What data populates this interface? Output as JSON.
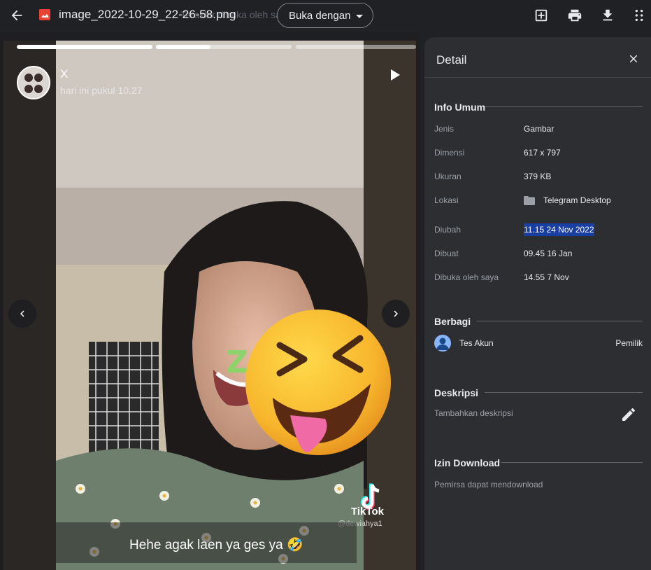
{
  "topbar": {
    "filename": "image_2022-10-29_22-26-58.png",
    "ghost_text": "Terakhir dibuka oleh saya · Disimpan di D",
    "open_with_label": "Buka dengan"
  },
  "story": {
    "progress": [
      1.0,
      0.4,
      0.0
    ],
    "username": "X",
    "time": "hari ini pukul 10.27",
    "tiktok_label": "TikTok",
    "tiktok_user": "@dewiahya1",
    "caption": "Hehe agak laen ya ges ya 🤣"
  },
  "panel": {
    "title": "Detail",
    "general": {
      "title": "Info Umum",
      "rows": [
        {
          "label": "Jenis",
          "value": "Gambar"
        },
        {
          "label": "Dimensi",
          "value": "617 x 797"
        },
        {
          "label": "Ukuran",
          "value": "379 KB"
        },
        {
          "label": "Lokasi",
          "value": "Telegram Desktop"
        },
        {
          "label": "Diubah",
          "value": "11.15 24 Nov 2022"
        },
        {
          "label": "Dibuat",
          "value": "09.45 16 Jan"
        },
        {
          "label": "Dibuka oleh saya",
          "value": "14.55 7 Nov"
        }
      ]
    },
    "sharing": {
      "title": "Berbagi",
      "user": "Tes Akun",
      "role": "Pemilik"
    },
    "description": {
      "title": "Deskripsi",
      "placeholder": "Tambahkan deskripsi"
    },
    "download": {
      "title": "Izin Download",
      "text": "Pemirsa dapat mendownload"
    }
  },
  "colors": {
    "background": "#202124",
    "panel": "#2d2e31",
    "highlight": "#1a3fa3",
    "file_icon": "#e94235"
  }
}
